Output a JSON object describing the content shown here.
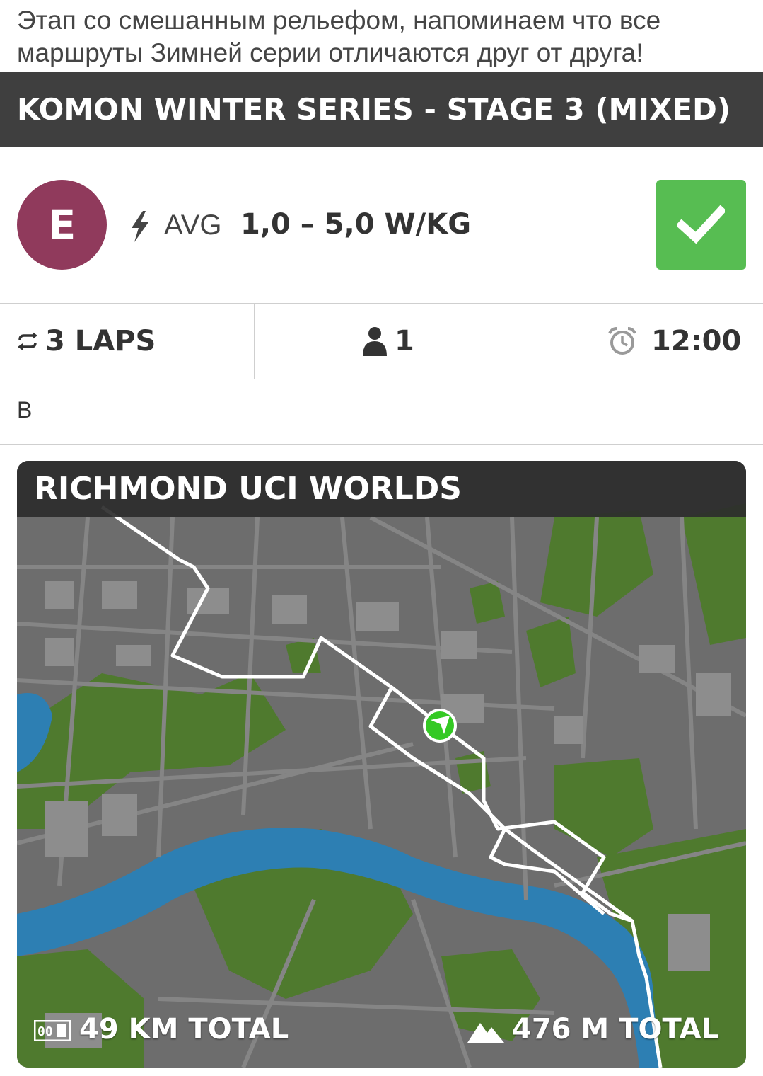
{
  "event": {
    "description": "Этап со смешанным рельефом, напоминаем что все маршруты Зимней серии отличаются друг от друга!",
    "title": "KOMON WINTER SERIES - STAGE 3 (MIXED)"
  },
  "category": {
    "letter": "E",
    "color": "#903a5c",
    "avg_label": "AVG",
    "range": "1,0 – 5,0 W/KG",
    "joined_color": "#57bd52",
    "icons": [
      "bolt-icon",
      "checkmark-icon"
    ]
  },
  "stats": {
    "laps": "3 LAPS",
    "riders": "1",
    "time": "12:00",
    "icons": [
      "repeat-icon",
      "person-icon",
      "alarm-clock-icon"
    ]
  },
  "note": "B",
  "map": {
    "route_name": "RICHMOND UCI WORLDS",
    "distance": "49 KM TOTAL",
    "elevation": "476 M TOTAL",
    "icons": [
      "odometer-icon",
      "mountain-icon",
      "position-marker-icon"
    ],
    "colors": {
      "water": "#2d7fb3",
      "park": "#4f7a2e",
      "route": "#ffffff",
      "marker": "#34c924"
    }
  }
}
